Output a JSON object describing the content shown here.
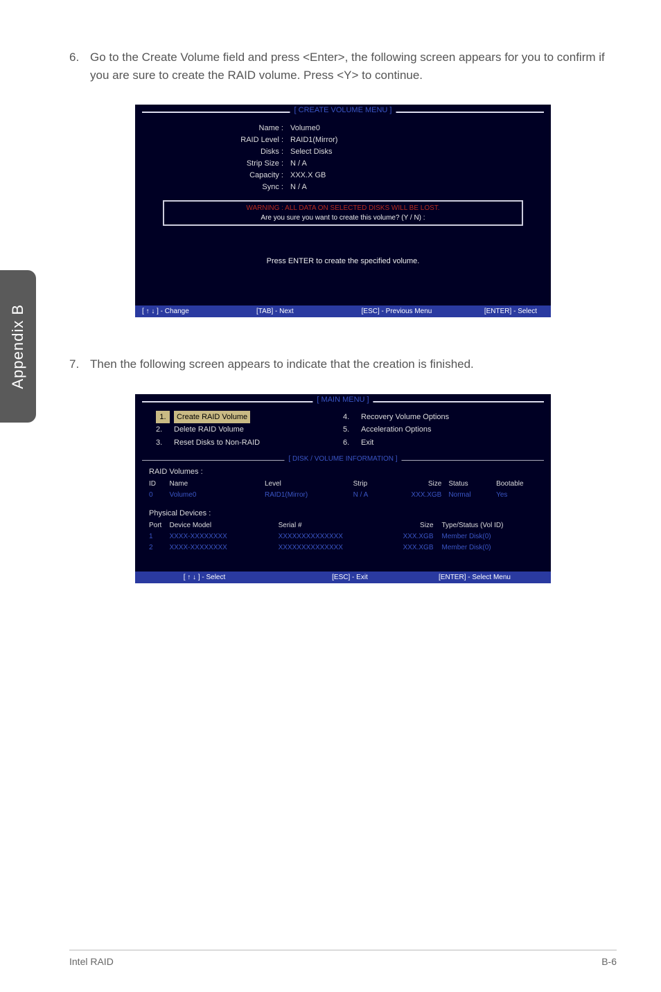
{
  "sideTab": "Appendix B",
  "step6": {
    "num": "6.",
    "text": "Go to the Create Volume field and press <Enter>, the following screen appears for you to confirm if you are sure to create the RAID volume. Press <Y> to continue."
  },
  "step7": {
    "num": "7.",
    "text": "Then the following screen appears to indicate that the creation is finished."
  },
  "bios1": {
    "title": "[  CREATE VOLUME MENU  ]",
    "rows": [
      {
        "label": "Name :",
        "val": "Volume0"
      },
      {
        "label": "RAID Level :",
        "val": "RAID1(Mirror)"
      },
      {
        "label": "Disks :",
        "val": "Select  Disks"
      },
      {
        "label": "Strip Size :",
        "val": "N / A"
      },
      {
        "label": "Capacity :",
        "val": "XXX.X  GB"
      },
      {
        "label": "Sync :",
        "val": "N / A"
      }
    ],
    "warnRed": "WARNING :  ALL  DATA  ON  SELECTED  DISKS  WILL  BE  LOST.",
    "warnWhite": "Are  you  sure  you  want  to  create  this  volume?  (Y / N)  :",
    "centerMsg": "Press  ENTER  to  create  the  specified  volume.",
    "footer": [
      "[ ↑ ↓ ] - Change",
      "[TAB] - Next",
      "[ESC] - Previous Menu",
      "[ENTER] - Select"
    ]
  },
  "bios2": {
    "title": "[   MAIN  MENU   ]",
    "menuLeft": [
      {
        "idx": "1.",
        "label": "Create  RAID  Volume",
        "hl": true
      },
      {
        "idx": "2.",
        "label": "Delete  RAID  Volume",
        "hl": false
      },
      {
        "idx": "3.",
        "label": "Reset Disks to Non-RAID",
        "hl": false
      }
    ],
    "menuRight": [
      {
        "idx": "4.",
        "label": "Recovery Volume  Options"
      },
      {
        "idx": "5.",
        "label": "Acceleration Options"
      },
      {
        "idx": "6.",
        "label": "Exit"
      }
    ],
    "subTitle": "[   DISK / VOLUME INFORMATION   ]",
    "raidLabel": "RAID  Volumes :",
    "raidHead": {
      "id": "ID",
      "name": "Name",
      "level": "Level",
      "strip": "Strip",
      "size": "Size",
      "status": "Status",
      "boot": "Bootable"
    },
    "raidRow": {
      "id": "0",
      "name": "Volume0",
      "level": "RAID1(Mirror)",
      "strip": "N / A",
      "size": "XXX.XGB",
      "status": "Normal",
      "boot": "Yes"
    },
    "physLabel": "Physical  Devices :",
    "physHead": {
      "port": "Port",
      "model": "Device  Model",
      "serial": "Serial  #",
      "size": "Size",
      "type": "Type/Status (Vol  ID)"
    },
    "physRows": [
      {
        "port": "1",
        "model": "XXXX-XXXXXXXX",
        "serial": "XXXXXXXXXXXXXX",
        "size": "XXX.XGB",
        "type": "Member  Disk(0)"
      },
      {
        "port": "2",
        "model": "XXXX-XXXXXXXX",
        "serial": "XXXXXXXXXXXXXX",
        "size": "XXX.XGB",
        "type": "Member  Disk(0)"
      }
    ],
    "footer": [
      "[ ↑ ↓ ] - Select",
      "[ESC] - Exit",
      "[ENTER] - Select Menu"
    ]
  },
  "pageFooter": {
    "left": "Intel RAID",
    "right": "B-6"
  }
}
